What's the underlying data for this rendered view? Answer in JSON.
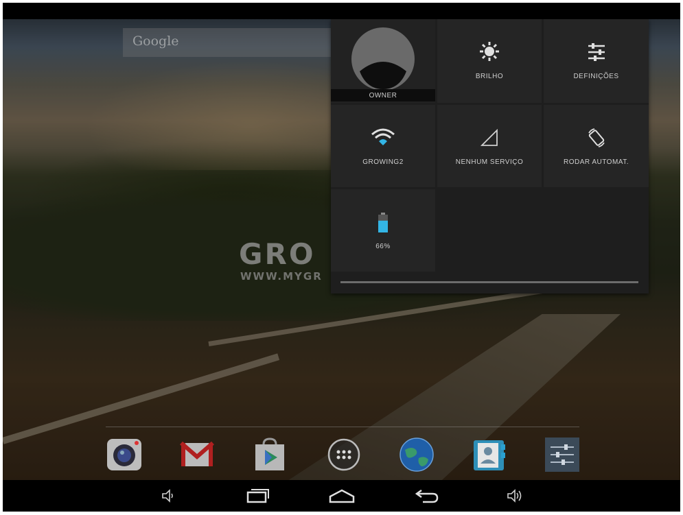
{
  "search": {
    "logo_text": "Google"
  },
  "wallpaper": {
    "watermark_title": "GRO",
    "watermark_subtitle": "WWW.MYGR"
  },
  "quick_settings": {
    "owner": {
      "label": "OWNER"
    },
    "brightness": {
      "label": "BRILHO",
      "icon": "brightness-icon"
    },
    "settings": {
      "label": "DEFINIÇÕES",
      "icon": "settings-sliders-icon"
    },
    "wifi": {
      "label": "GROWING2",
      "icon": "wifi-icon"
    },
    "mobile_signal": {
      "label": "NENHUM SERVIÇO",
      "icon": "signal-icon"
    },
    "auto_rotate": {
      "label": "RODAR AUTOMAT.",
      "icon": "rotate-icon"
    },
    "battery": {
      "label": "66%",
      "level": 0.66,
      "icon": "battery-icon"
    }
  },
  "dock": {
    "apps": [
      {
        "name": "camera",
        "icon": "camera-icon"
      },
      {
        "name": "gmail",
        "icon": "gmail-icon"
      },
      {
        "name": "play-store",
        "icon": "play-store-icon"
      },
      {
        "name": "app-drawer",
        "icon": "app-drawer-icon"
      },
      {
        "name": "browser",
        "icon": "globe-icon"
      },
      {
        "name": "contacts",
        "icon": "contacts-icon"
      },
      {
        "name": "settings",
        "icon": "settings-app-icon"
      }
    ]
  },
  "navbar": {
    "buttons": [
      "volume-down-icon",
      "recents-icon",
      "home-icon",
      "back-icon",
      "volume-up-icon"
    ]
  },
  "colors": {
    "accent": "#33b5e5",
    "panel": "#1e1e1e",
    "tile": "#252525"
  }
}
